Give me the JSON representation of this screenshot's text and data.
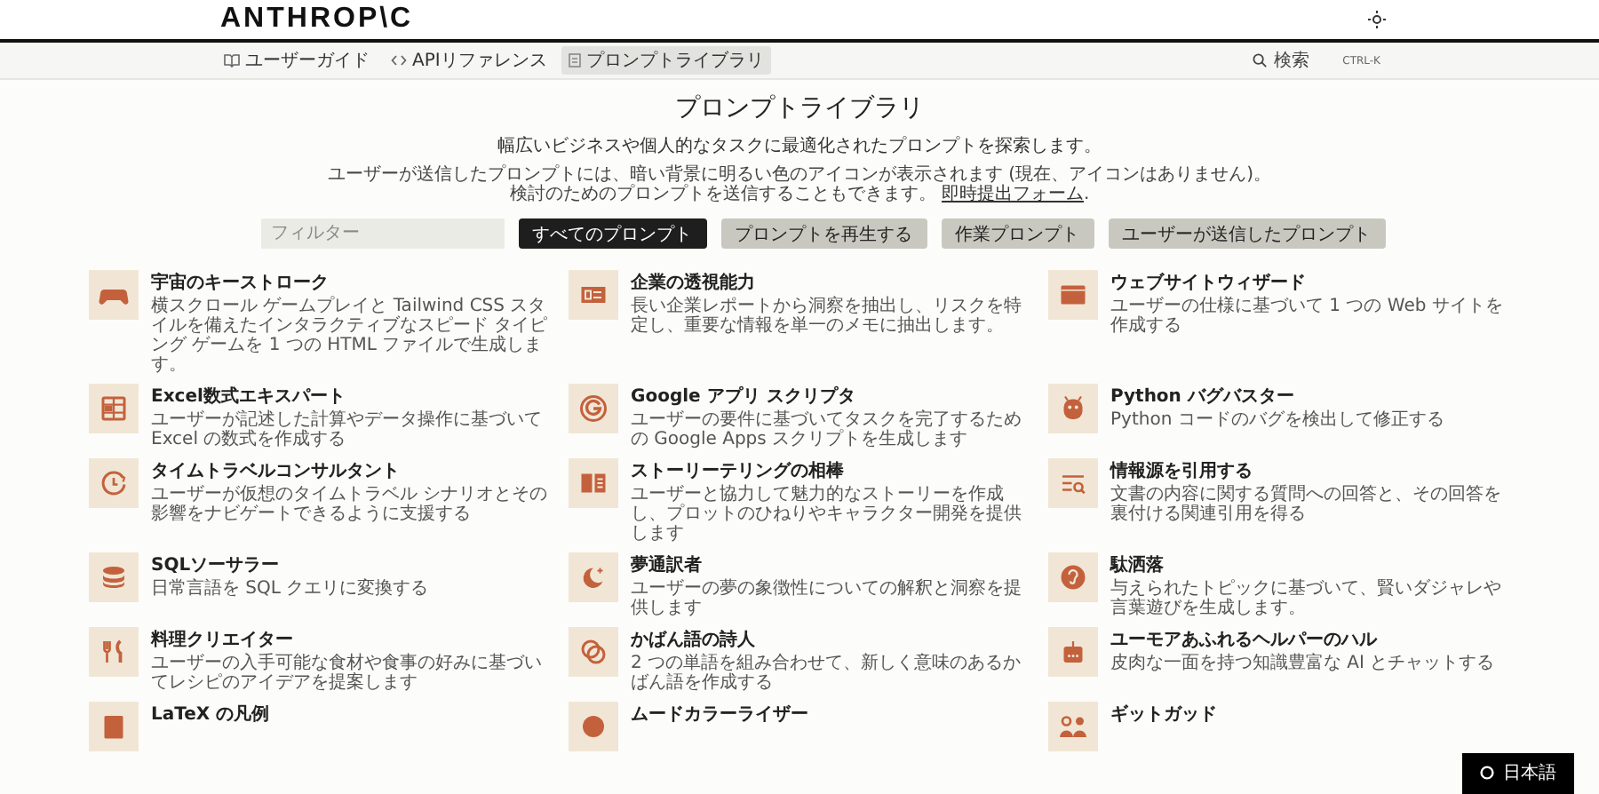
{
  "header": {
    "logo": "ANTHROP\\C"
  },
  "nav": {
    "tabs": [
      {
        "label": "ユーザーガイド",
        "selected": false
      },
      {
        "label": "APIリファレンス",
        "selected": false
      },
      {
        "label": "プロンプトライブラリ",
        "selected": true
      }
    ],
    "search": {
      "placeholder": "検索",
      "shortcut": "CTRL-K"
    }
  },
  "intro": {
    "title": "プロンプトライブラリ",
    "subtitle": "幅広いビジネスや個人的なタスクに最適化されたプロンプトを探索します。",
    "note": "ユーザーが送信したプロンプトには、暗い背景に明るい色のアイコンが表示されます (現在、アイコンはありません)。",
    "note_2": "検討のためのプロンプトを送信することもできます。",
    "link": "即時提出フォーム",
    "note_end": "."
  },
  "filter": {
    "placeholder": "フィルター"
  },
  "categories": [
    {
      "label": "すべてのプロンプト",
      "selected": true
    },
    {
      "label": "プロンプトを再生する",
      "selected": false
    },
    {
      "label": "作業プロンプト",
      "selected": false
    },
    {
      "label": "ユーザーが送信したプロンプト",
      "selected": false
    }
  ],
  "prompts": [
    {
      "title": "宇宙のキーストローク",
      "description": "横スクロール ゲームプレイと Tailwind CSS スタイルを備えたインタラクティブなスピード タイピング ゲームを 1 つの HTML ファイルで生成します。"
    },
    {
      "title": "企業の透視能力",
      "description": "長い企業レポートから洞察を抽出し、リスクを特定し、重要な情報を単一のメモに抽出します。"
    },
    {
      "title": "ウェブサイトウィザード",
      "description": "ユーザーの仕様に基づいて 1 つの Web サイトを作成する"
    },
    {
      "title": "Excel数式エキスパート",
      "description": "ユーザーが記述した計算やデータ操作に基づいて Excel の数式を作成する"
    },
    {
      "title": "Google アプリ スクリプタ",
      "description": "ユーザーの要件に基づいてタスクを完了するための Google Apps スクリプトを生成します"
    },
    {
      "title": "Python バグバスター",
      "description": "Python コードのバグを検出して修正する"
    },
    {
      "title": "タイムトラベルコンサルタント",
      "description": "ユーザーが仮想のタイムトラベル シナリオとその影響をナビゲートできるように支援する"
    },
    {
      "title": "ストーリーテリングの相棒",
      "description": "ユーザーと協力して魅力的なストーリーを作成し、プロットのひねりやキャラクター開発を提供します"
    },
    {
      "title": "情報源を引用する",
      "description": "文書の内容に関する質問への回答と、その回答を裏付ける関連引用を得る"
    },
    {
      "title": "SQLソーサラー",
      "description": "日常言語を SQL クエリに変換する"
    },
    {
      "title": "夢通訳者",
      "description": "ユーザーの夢の象徴性についての解釈と洞察を提供します"
    },
    {
      "title": "駄洒落",
      "description": "与えられたトピックに基づいて、賢いダジャレや言葉遊びを生成します。"
    },
    {
      "title": "料理クリエイター",
      "description": "ユーザーの入手可能な食材や食事の好みに基づいてレシピのアイデアを提案します"
    },
    {
      "title": "かばん語の詩人",
      "description": "2 つの単語を組み合わせて、新しく意味のあるかばん語を作成する"
    },
    {
      "title": "ユーモアあふれるヘルパーのハル",
      "description": "皮肉な一面を持つ知識豊富な AI とチャットする"
    },
    {
      "title": "LaTeX の凡例"
    },
    {
      "title": "ムードカラーライザー"
    },
    {
      "title": "ギットガッド"
    }
  ],
  "language": {
    "label": "日本語"
  }
}
